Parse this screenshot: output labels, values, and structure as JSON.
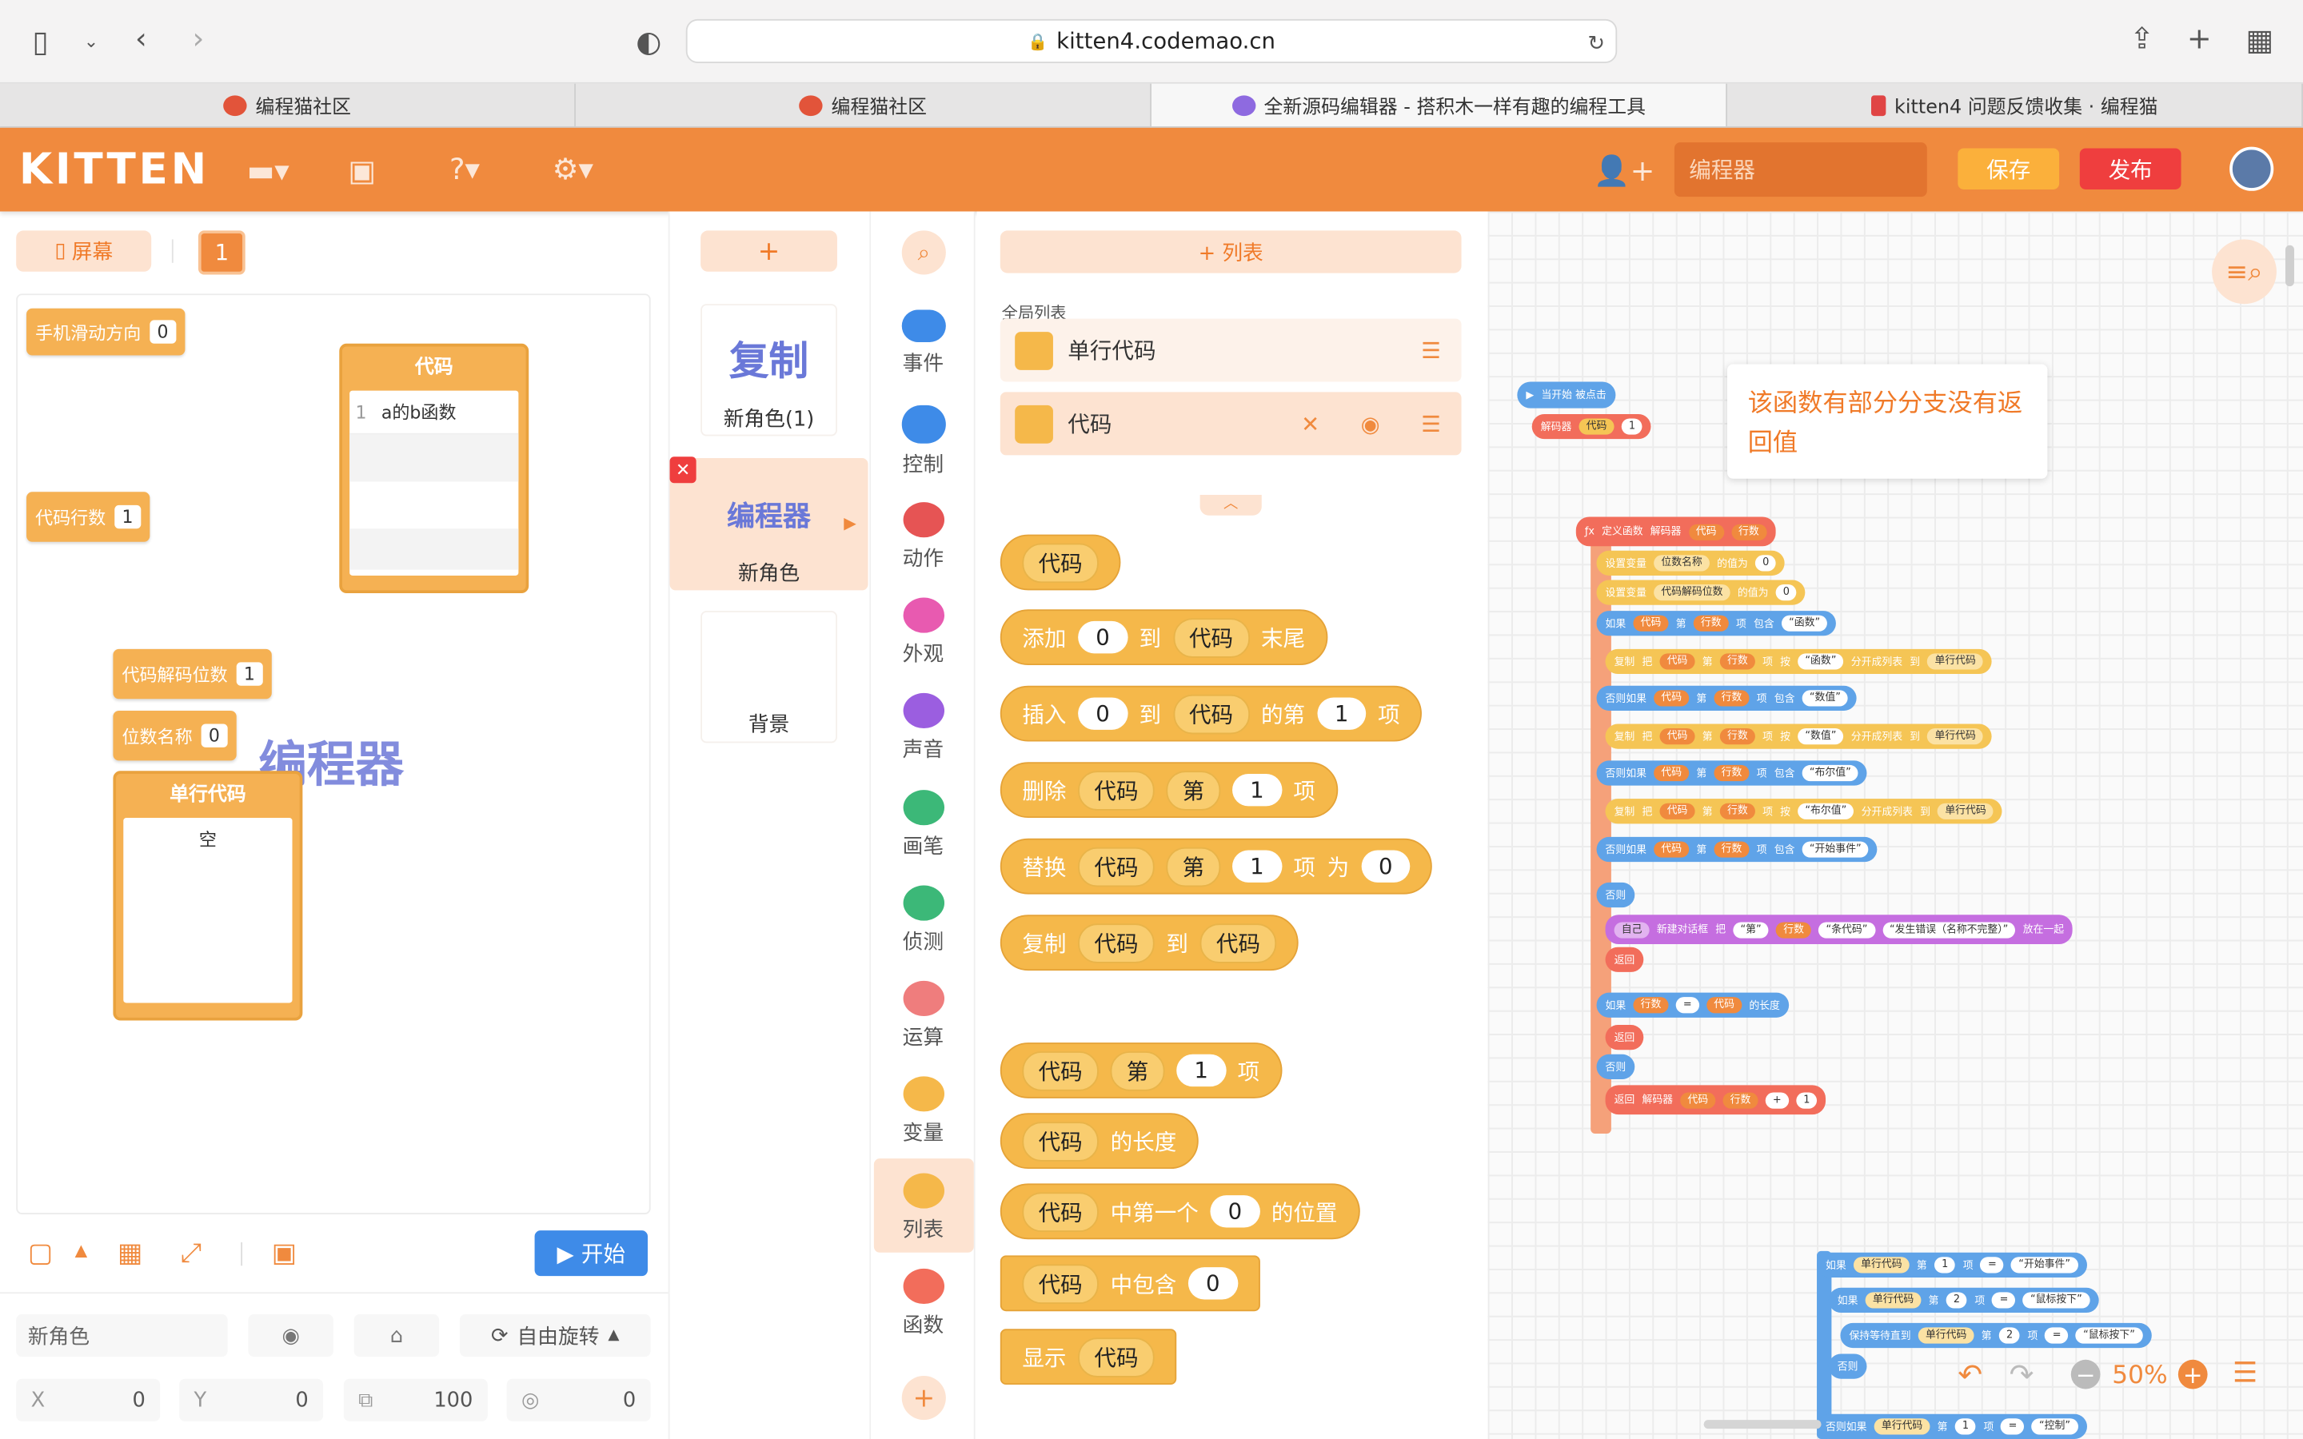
{
  "browser": {
    "url": "kitten4.codemao.cn",
    "tabs": [
      "编程猫社区",
      "编程猫社区",
      "全新源码编辑器 - 搭积木一样有趣的编程工具",
      "kitten4 问题反馈收集 · 编程猫"
    ]
  },
  "header": {
    "logo": "KITTEN",
    "project_name_placeholder": "编程器",
    "save_label": "保存",
    "publish_label": "发布"
  },
  "stage": {
    "screen_label": "屏幕",
    "screen_index": "1",
    "monitors": {
      "swipe": {
        "label": "手机滑动方向",
        "value": "0"
      },
      "lines": {
        "label": "代码行数",
        "value": "1"
      },
      "decode_pos": {
        "label": "代码解码位数",
        "value": "1"
      },
      "name_pos": {
        "label": "位数名称",
        "value": "0"
      }
    },
    "list_code": {
      "title": "代码",
      "item_index": "1",
      "item": "a的b函数"
    },
    "list_single": {
      "title": "单行代码",
      "item": "空"
    },
    "overlay_text": "编程器",
    "start_label": "开始"
  },
  "sprite_props": {
    "name": "新角色",
    "rotation": "自由旋转",
    "x_label": "X",
    "x": "0",
    "y_label": "Y",
    "y": "0",
    "size": "100",
    "direction": "0"
  },
  "sprites": {
    "add": "+",
    "items": [
      {
        "thumb": "复制",
        "name": "新角色(1)"
      },
      {
        "thumb": "编程器",
        "name": "新角色"
      },
      {
        "thumb": "",
        "name": "背景"
      }
    ]
  },
  "categories": [
    "事件",
    "控制",
    "动作",
    "外观",
    "声音",
    "画笔",
    "侦测",
    "运算",
    "变量",
    "列表",
    "函数"
  ],
  "palette": {
    "add_list": "+ 列表",
    "global_list": "全局列表",
    "lists": [
      "单行代码",
      "代码"
    ],
    "blocks": {
      "b1": [
        "代码"
      ],
      "b2": [
        "添加",
        "0",
        "到",
        "代码",
        "末尾"
      ],
      "b3": [
        "插入",
        "0",
        "到",
        "代码",
        "的第",
        "1",
        "项"
      ],
      "b4": [
        "删除",
        "代码",
        "第",
        "1",
        "项"
      ],
      "b5": [
        "替换",
        "代码",
        "第",
        "1",
        "项",
        "为",
        "0"
      ],
      "b6": [
        "复制",
        "代码",
        "到",
        "代码"
      ],
      "b7": [
        "代码",
        "第",
        "1",
        "项"
      ],
      "b8": [
        "代码",
        "的长度"
      ],
      "b9": [
        "代码",
        "中第一个",
        "0",
        "的位置"
      ],
      "b10": [
        "代码",
        "中包含",
        "0"
      ],
      "b11": [
        "显示",
        "代码"
      ]
    }
  },
  "script": {
    "tooltip": "该函数有部分分支没有返回值",
    "zoom": "50%",
    "hat": "当开始 被点击",
    "call": [
      "解码器",
      "代码",
      "1"
    ],
    "def": [
      "定义函数",
      "解码器",
      "代码",
      "行数"
    ],
    "rows": [
      [
        "设置变量",
        "位数名称",
        "的值为",
        "0"
      ],
      [
        "设置变量",
        "代码解码位数",
        "的值为",
        "0"
      ],
      [
        "如果",
        "代码",
        "第",
        "行数",
        "项",
        "包含",
        "“函数”"
      ],
      [
        "复制",
        "把",
        "代码",
        "第",
        "行数",
        "项",
        "按",
        "“函数”",
        "分开成列表",
        "到",
        "单行代码"
      ],
      [
        "否则如果",
        "代码",
        "第",
        "行数",
        "项",
        "包含",
        "“数值”"
      ],
      [
        "复制",
        "把",
        "代码",
        "第",
        "行数",
        "项",
        "按",
        "“数值”",
        "分开成列表",
        "到",
        "单行代码"
      ],
      [
        "否则如果",
        "代码",
        "第",
        "行数",
        "项",
        "包含",
        "“布尔值”"
      ],
      [
        "复制",
        "把",
        "代码",
        "第",
        "行数",
        "项",
        "按",
        "“布尔值”",
        "分开成列表",
        "到",
        "单行代码"
      ],
      [
        "否则如果",
        "代码",
        "第",
        "行数",
        "项",
        "包含",
        "“开始事件”"
      ],
      [
        "否则"
      ],
      [
        "自己",
        "新建对话框",
        "把",
        "“第”",
        "行数",
        "“条代码”",
        "“发生错误（名称不完整）”",
        "放在一起"
      ],
      [
        "返回"
      ],
      [
        "如果",
        "行数",
        "=",
        "代码",
        "的长度"
      ],
      [
        "返回"
      ],
      [
        "否则"
      ],
      [
        "返回",
        "解码器",
        "代码",
        "行数",
        "+",
        "1"
      ]
    ],
    "rows2": [
      [
        "如果",
        "单行代码",
        "第",
        "1",
        "项",
        "=",
        "“开始事件”"
      ],
      [
        "如果",
        "单行代码",
        "第",
        "2",
        "项",
        "=",
        "“鼠标按下”"
      ],
      [
        "保持等待直到",
        "单行代码",
        "第",
        "2",
        "项",
        "=",
        "“鼠标按下”"
      ],
      [
        "否则"
      ],
      [
        "否则如果",
        "单行代码",
        "第",
        "1",
        "项",
        "=",
        "“控制”"
      ]
    ]
  },
  "colors": {
    "accent": "#f08a3e",
    "list_block": "#f5b84a",
    "func": "#f26d5b",
    "dialog": "#c56ee0"
  }
}
